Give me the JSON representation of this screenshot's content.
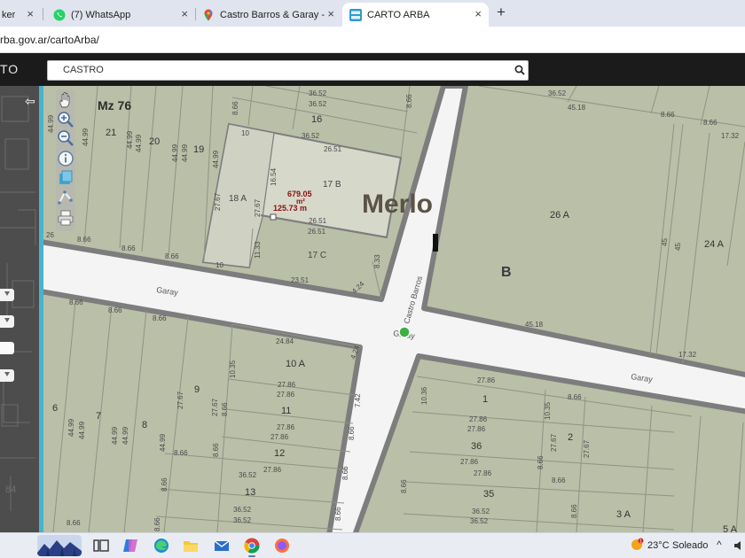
{
  "browser": {
    "tabs": [
      {
        "label": "ker"
      },
      {
        "label": "(7) WhatsApp"
      },
      {
        "label": "Castro Barros & Garay - Google"
      },
      {
        "label": "CARTO ARBA"
      }
    ],
    "new_tab": "+",
    "close_glyph": "×",
    "address": "rba.gov.ar/cartoArba/"
  },
  "app": {
    "title": "TO",
    "search": {
      "value": "CASTRO"
    },
    "back": "⇦"
  },
  "map": {
    "manzana": "Mz 76",
    "locality": "Merlo",
    "block": "B",
    "streets": {
      "garay_left": "Garay",
      "garay_center": "Garay",
      "garay_right": "Garay",
      "castro_barros": "Castro Barros"
    },
    "area_label": "679.05",
    "area_unit": "m²",
    "perimeter_label": "125.73 m",
    "parcels": {
      "p16": "16",
      "p21": "21",
      "p20": "20",
      "p19": "19",
      "p18a": "18 A",
      "p17b": "17 B",
      "p17c": "17 C",
      "p26a": "26 A",
      "p24a": "24 A",
      "p10a": "10 A",
      "p9": "9",
      "p11": "11",
      "p12": "12",
      "p13": "13",
      "p8": "8",
      "p7": "7",
      "p6": "6",
      "p1": "1",
      "p2": "2",
      "p36": "36",
      "p35": "35",
      "p3a": "3 A",
      "p5a": "5 A"
    },
    "dims": {
      "d1": "36.52",
      "d2": "36.52",
      "d3": "36.52",
      "d4": "8.66",
      "d5": "8.66",
      "d6": "44.99",
      "d7": "44.99",
      "d8": "44.99",
      "d9": "44.99",
      "d10": "44.99",
      "d11": "44.99",
      "d12": "44.99",
      "d13": "10",
      "d14": "26.51",
      "d15": "16.54",
      "d16": "27.67",
      "d17": "27.67",
      "d18": "26.51",
      "d19": "26.51",
      "d20": "11.33",
      "d21": "8.33",
      "d22": "23.51",
      "d23": "4.24",
      "d24": "8.66",
      "d25": "8.66",
      "d26": "8.66",
      "d27": "10",
      "d28": "36.52",
      "d29": "45.18",
      "d30": "8.66",
      "d31": "8.66",
      "d32": "17.32",
      "d33": "45",
      "d34": "45",
      "d35": "45.18",
      "d36": "17.32",
      "d37": "24.84",
      "d38": "4.24",
      "d39": "10.35",
      "d40": "27.86",
      "d41": "27.86",
      "d42": "27.86",
      "d43": "27.86",
      "d44": "27.86",
      "d45": "7.42",
      "d46": "8.66",
      "d47": "8.66",
      "d48": "36.52",
      "d49": "36.52",
      "d50": "36.52",
      "d51": "8.66",
      "d52": "27.67",
      "d53": "27.67",
      "d54": "8.66",
      "d55": "8.66",
      "d56": "8.66",
      "d57": "8.66",
      "d58": "8.66",
      "d59": "8.66",
      "d60": "44.99",
      "d61": "44.99",
      "d62": "44.99",
      "d63": "44.99",
      "d64": "44.99",
      "d65": "27.86",
      "d66": "10.36",
      "d67": "8.66",
      "d68": "27.86",
      "d69": "27.86",
      "d70": "10.35",
      "d71": "27.67",
      "d72": "27.67",
      "d73": "27.86",
      "d74": "8.66",
      "d75": "8.66",
      "d76": "27.86",
      "d77": "8.66",
      "d78": "36.52",
      "d79": "36.52",
      "d80": "8.66",
      "d81": "8.66",
      "d82": "26",
      "d83": "8.66",
      "d84": "8.66"
    },
    "colors": {
      "parcel": "#babfa8",
      "selected": "#d6d8ca",
      "street": "#f4f4f4",
      "boundary": "#7d7d7d",
      "accent": "#48b3cc"
    },
    "sidebar_partial": "84"
  },
  "taskbar": {
    "weather_temp": "23°C",
    "weather_cond": "Soleado",
    "badge": "1",
    "chevron": "^"
  }
}
